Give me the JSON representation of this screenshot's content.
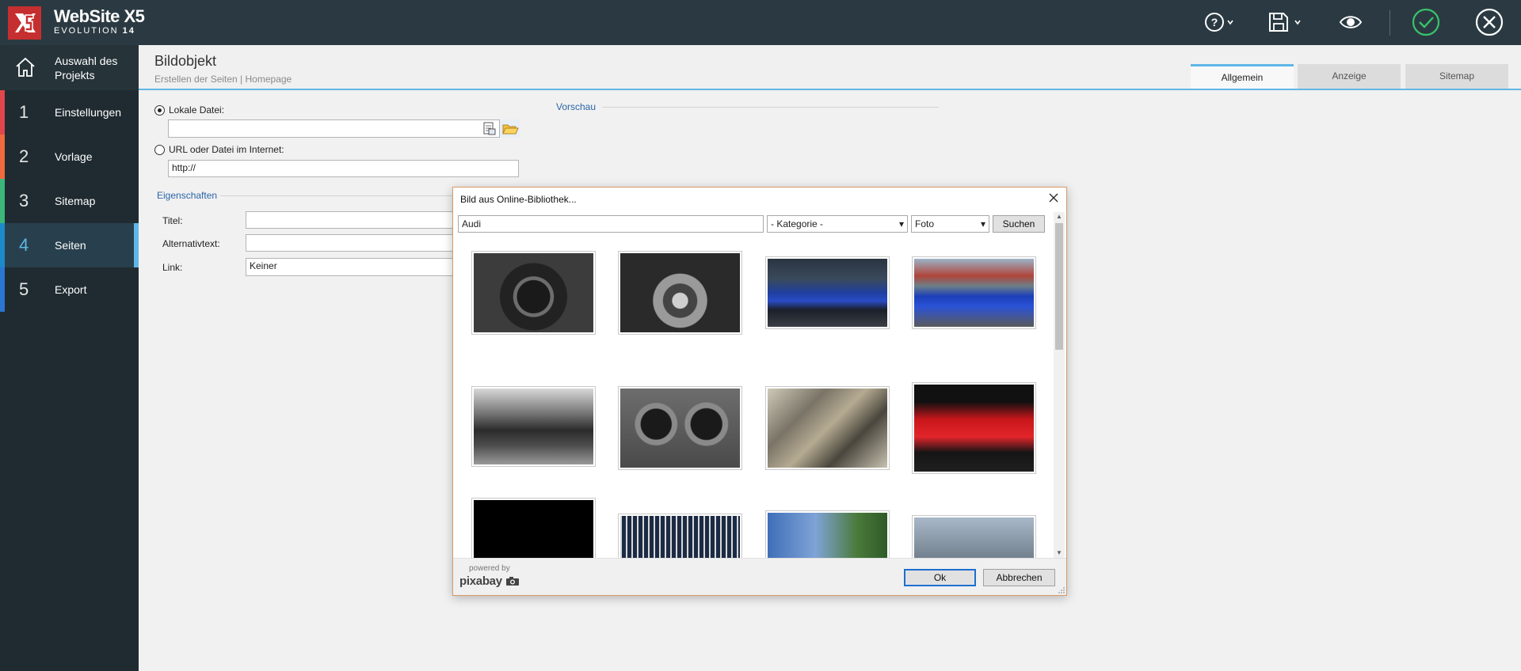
{
  "app": {
    "logo_icon": "websitex5-logo",
    "title": "WebSite X5",
    "subtitle": "EVOLUTION",
    "version": "14"
  },
  "toolbar": {
    "help_icon": "help-icon",
    "save_icon": "save-icon",
    "preview_icon": "eye-icon",
    "confirm_icon": "check-circle-icon",
    "close_icon": "close-circle-icon"
  },
  "sidebar": {
    "home_label": "Auswahl des Projekts",
    "items": [
      {
        "num": "1",
        "label": "Einstellungen",
        "color": "#e0464b"
      },
      {
        "num": "2",
        "label": "Vorlage",
        "color": "#f06a3c"
      },
      {
        "num": "3",
        "label": "Sitemap",
        "color": "#3bb879"
      },
      {
        "num": "4",
        "label": "Seiten",
        "color": "#1c8ac9"
      },
      {
        "num": "5",
        "label": "Export",
        "color": "#2a76d2"
      }
    ]
  },
  "header": {
    "title": "Bildobjekt",
    "breadcrumb": "Erstellen der Seiten | Homepage",
    "tabs": [
      "Allgemein",
      "Anzeige",
      "Sitemap"
    ],
    "active_tab": "Allgemein"
  },
  "form": {
    "local_file_label": "Lokale Datei:",
    "local_file_value": "",
    "url_label": "URL oder Datei im Internet:",
    "url_value": "http://",
    "preview_section": "Vorschau",
    "properties_section": "Eigenschaften",
    "title_label": "Titel:",
    "title_value": "",
    "alt_label": "Alternativtext:",
    "alt_value": "",
    "link_label": "Link:",
    "link_value": "Keiner"
  },
  "dialog": {
    "title": "Bild aus Online-Bibliothek...",
    "search_value": "Audi",
    "category_value": "- Kategorie -",
    "type_value": "Foto",
    "search_button": "Suchen",
    "ok_button": "Ok",
    "cancel_button": "Abbrechen",
    "powered_by": "powered by",
    "provider": "pixabay",
    "thumbnails": [
      {
        "name": "audi-cockpit-steering-wheel"
      },
      {
        "name": "audi-gear-shift"
      },
      {
        "name": "blue-audi-coupe"
      },
      {
        "name": "blue-audi-sedan"
      },
      {
        "name": "audi-sedan-black-white"
      },
      {
        "name": "audi-air-vents"
      },
      {
        "name": "audi-engine-detail"
      },
      {
        "name": "red-audi-r8"
      },
      {
        "name": "black-image"
      },
      {
        "name": "audi-dark-partial"
      },
      {
        "name": "audi-sky-trees-partial"
      },
      {
        "name": "audi-grey-partial"
      }
    ]
  }
}
